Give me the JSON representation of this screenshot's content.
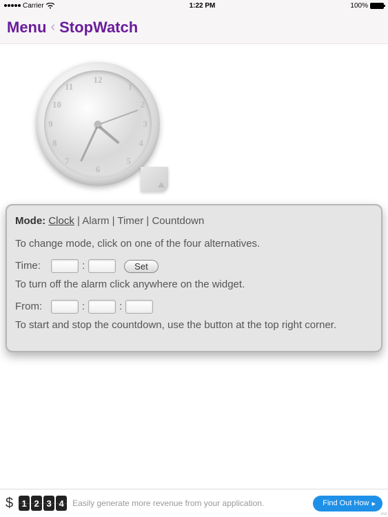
{
  "statusbar": {
    "carrier": "Carrier",
    "wifi": "wifi-icon",
    "time": "1:22 PM",
    "battery_pct": "100%"
  },
  "nav": {
    "menu": "Menu",
    "title": "StopWatch"
  },
  "clock": {
    "numbers": [
      "12",
      "1",
      "2",
      "3",
      "4",
      "5",
      "6",
      "7",
      "8",
      "9",
      "10",
      "11"
    ],
    "tab_symbol": "▲"
  },
  "panel": {
    "mode_label": "Mode:",
    "modes": [
      "Clock",
      "Alarm",
      "Timer",
      "Countdown"
    ],
    "active_mode_index": 0,
    "hint_mode": "To change mode, click on one of the four alternatives.",
    "time_label": "Time:",
    "set_label": "Set",
    "hint_alarm": "To turn off the alarm click anywhere on the widget.",
    "from_label": "From:",
    "hint_countdown": "To start and stop the countdown, use the button at the top right corner."
  },
  "ad": {
    "dollar": "$",
    "digits": [
      "1",
      "2",
      "3",
      "4"
    ],
    "text": "Easily generate more revenue from your application.",
    "cta": "Find Out How",
    "tag": "iAd"
  }
}
